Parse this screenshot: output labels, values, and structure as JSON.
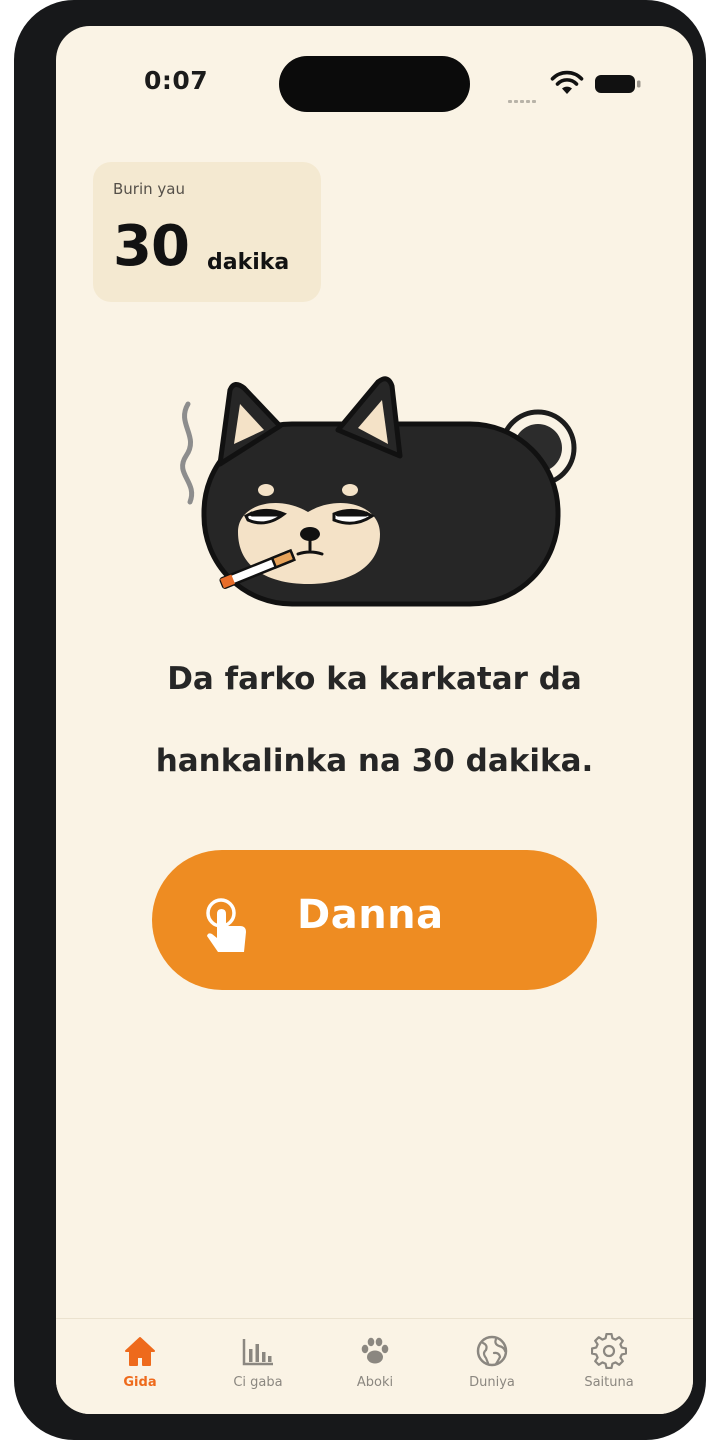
{
  "status_bar": {
    "time": "0:07",
    "wifi_icon": "wifi-icon",
    "battery_icon": "battery-icon"
  },
  "daily_card": {
    "label": "Burin yau",
    "value": "30",
    "unit": "dakika"
  },
  "mascot": {
    "icon": "smoking-dog-mascot"
  },
  "message": {
    "line1": "Da farko ka karkatar da",
    "line2": "hankalinka na 30 dakika."
  },
  "action_button": {
    "label": "Danna",
    "icon": "tap-hand-icon"
  },
  "tabs": [
    {
      "label": "Gida",
      "icon": "home-icon",
      "active": true
    },
    {
      "label": "Ci gaba",
      "icon": "bar-chart-icon",
      "active": false
    },
    {
      "label": "Aboki",
      "icon": "paw-icon",
      "active": false
    },
    {
      "label": "Duniya",
      "icon": "globe-icon",
      "active": false
    },
    {
      "label": "Saituna",
      "icon": "gear-icon",
      "active": false
    }
  ],
  "colors": {
    "background": "#faf3e5",
    "card": "#f4e9d1",
    "accent": "#ee8c22",
    "tab_active": "#ee6a1c",
    "tab_inactive": "#8b8780"
  }
}
